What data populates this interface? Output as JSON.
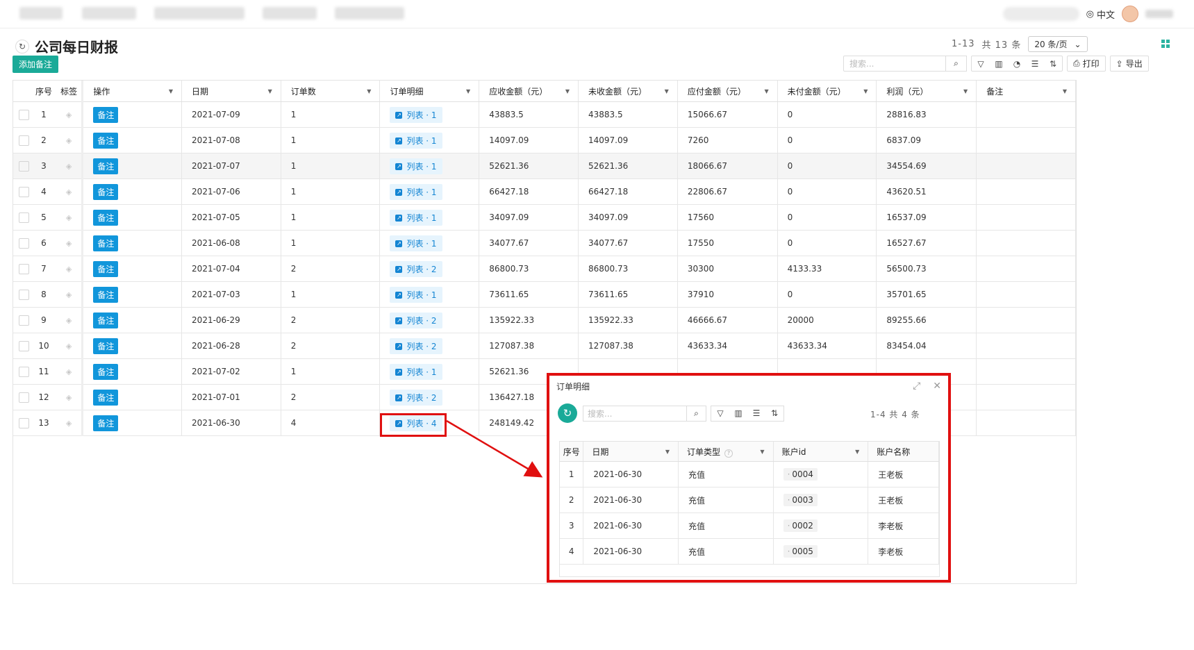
{
  "topbar": {
    "lang": "中文"
  },
  "page": {
    "title": "公司每日财报",
    "pager": {
      "range": "1-13",
      "total_label": "共 13 条",
      "page_size": "20 条/页"
    },
    "add_note": "添加备注",
    "search_placeholder": "搜索...",
    "print": "打印",
    "export": "导出"
  },
  "table": {
    "headers": {
      "seq": "序号",
      "tag": "标签",
      "action": "操作",
      "date": "日期",
      "orders": "订单数",
      "detail": "订单明细",
      "receivable": "应收金额（元）",
      "unreceived": "未收金额（元）",
      "payable": "应付金额（元）",
      "unpaid": "未付金额（元）",
      "profit": "利润（元）",
      "remark": "备注"
    },
    "note_label": "备注",
    "rows": [
      {
        "seq": "1",
        "date": "2021-07-09",
        "orders": "1",
        "detail": "列表 · 1",
        "receivable": "43883.5",
        "unreceived": "43883.5",
        "payable": "15066.67",
        "unpaid": "0",
        "profit": "28816.83"
      },
      {
        "seq": "2",
        "date": "2021-07-08",
        "orders": "1",
        "detail": "列表 · 1",
        "receivable": "14097.09",
        "unreceived": "14097.09",
        "payable": "7260",
        "unpaid": "0",
        "profit": "6837.09"
      },
      {
        "seq": "3",
        "date": "2021-07-07",
        "orders": "1",
        "detail": "列表 · 1",
        "receivable": "52621.36",
        "unreceived": "52621.36",
        "payable": "18066.67",
        "unpaid": "0",
        "profit": "34554.69"
      },
      {
        "seq": "4",
        "date": "2021-07-06",
        "orders": "1",
        "detail": "列表 · 1",
        "receivable": "66427.18",
        "unreceived": "66427.18",
        "payable": "22806.67",
        "unpaid": "0",
        "profit": "43620.51"
      },
      {
        "seq": "5",
        "date": "2021-07-05",
        "orders": "1",
        "detail": "列表 · 1",
        "receivable": "34097.09",
        "unreceived": "34097.09",
        "payable": "17560",
        "unpaid": "0",
        "profit": "16537.09"
      },
      {
        "seq": "6",
        "date": "2021-06-08",
        "orders": "1",
        "detail": "列表 · 1",
        "receivable": "34077.67",
        "unreceived": "34077.67",
        "payable": "17550",
        "unpaid": "0",
        "profit": "16527.67"
      },
      {
        "seq": "7",
        "date": "2021-07-04",
        "orders": "2",
        "detail": "列表 · 2",
        "receivable": "86800.73",
        "unreceived": "86800.73",
        "payable": "30300",
        "unpaid": "4133.33",
        "profit": "56500.73"
      },
      {
        "seq": "8",
        "date": "2021-07-03",
        "orders": "1",
        "detail": "列表 · 1",
        "receivable": "73611.65",
        "unreceived": "73611.65",
        "payable": "37910",
        "unpaid": "0",
        "profit": "35701.65"
      },
      {
        "seq": "9",
        "date": "2021-06-29",
        "orders": "2",
        "detail": "列表 · 2",
        "receivable": "135922.33",
        "unreceived": "135922.33",
        "payable": "46666.67",
        "unpaid": "20000",
        "profit": "89255.66"
      },
      {
        "seq": "10",
        "date": "2021-06-28",
        "orders": "2",
        "detail": "列表 · 2",
        "receivable": "127087.38",
        "unreceived": "127087.38",
        "payable": "43633.34",
        "unpaid": "43633.34",
        "profit": "83454.04"
      },
      {
        "seq": "11",
        "date": "2021-07-02",
        "orders": "1",
        "detail": "列表 · 1",
        "receivable": "52621.36",
        "unreceived": "",
        "payable": "",
        "unpaid": "",
        "profit": ""
      },
      {
        "seq": "12",
        "date": "2021-07-01",
        "orders": "2",
        "detail": "列表 · 2",
        "receivable": "136427.18",
        "unreceived": "",
        "payable": "",
        "unpaid": "",
        "profit": ""
      },
      {
        "seq": "13",
        "date": "2021-06-30",
        "orders": "4",
        "detail": "列表 · 4",
        "receivable": "248149.42",
        "unreceived": "",
        "payable": "",
        "unpaid": "",
        "profit": ""
      }
    ]
  },
  "dialog": {
    "title": "订单明细",
    "search_placeholder": "搜索...",
    "pager": "1-4 共 4 条",
    "headers": {
      "seq": "序号",
      "date": "日期",
      "type": "订单类型",
      "account_id": "账户id",
      "account_name": "账户名称"
    },
    "rows": [
      {
        "seq": "1",
        "date": "2021-06-30",
        "type": "充值",
        "account_id": "0004",
        "account_name": "王老板"
      },
      {
        "seq": "2",
        "date": "2021-06-30",
        "type": "充值",
        "account_id": "0003",
        "account_name": "王老板"
      },
      {
        "seq": "3",
        "date": "2021-06-30",
        "type": "充值",
        "account_id": "0002",
        "account_name": "李老板"
      },
      {
        "seq": "4",
        "date": "2021-06-30",
        "type": "充值",
        "account_id": "0005",
        "account_name": "李老板"
      }
    ]
  },
  "icons": {
    "refresh": "refresh-icon",
    "search": "search-icon",
    "filter": "filter-icon",
    "chart": "bar-chart-icon",
    "pie": "pie-chart-icon",
    "columns": "column-settings-icon",
    "sort": "sort-icon",
    "print": "printer-icon",
    "export": "export-icon",
    "tag": "tag-icon",
    "expand": "expand-icon",
    "close": "close-icon",
    "globe": "globe-icon"
  },
  "colors": {
    "primary_teal": "#1aaa98",
    "note_blue": "#1196db",
    "link_blue": "#1485d3",
    "highlight_red": "#e01010"
  }
}
